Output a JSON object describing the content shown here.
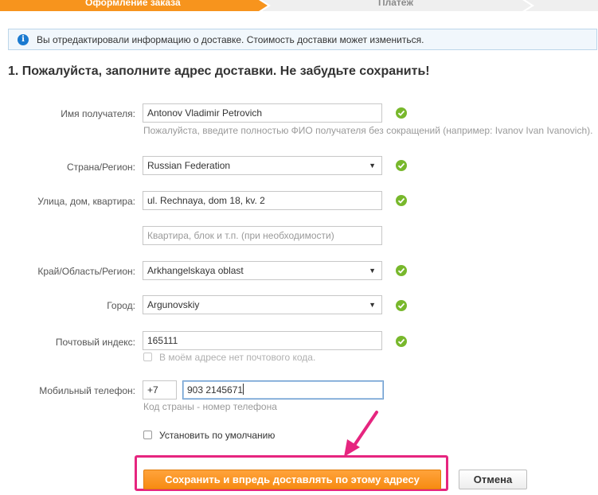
{
  "steps": [
    {
      "label": "Оформление заказа",
      "active": true
    },
    {
      "label": "Платёж",
      "active": false
    }
  ],
  "info": {
    "icon": "info-icon",
    "text": "Вы отредактировали информацию о доставке. Стоимость доставки может измениться."
  },
  "heading": "1. Пожалуйста, заполните адрес доставки. Не забудьте сохранить!",
  "form": {
    "recipient": {
      "label": "Имя получателя:",
      "value": "Antonov Vladimir Petrovich",
      "hint": "Пожалуйста, введите полностью ФИО получателя без сокращений (например: Ivanov Ivan Ivanovich)."
    },
    "country": {
      "label": "Страна/Регион:",
      "value": "Russian Federation"
    },
    "street": {
      "label": "Улица, дом, квартира:",
      "value": "ul. Rechnaya, dom 18, kv. 2"
    },
    "apartment": {
      "placeholder": "Квартира, блок и т.п. (при необходимости)"
    },
    "region": {
      "label": "Край/Область/Регион:",
      "value": "Arkhangelskaya oblast"
    },
    "city": {
      "label": "Город:",
      "value": "Argunovskiy"
    },
    "postal": {
      "label": "Почтовый индекс:",
      "value": "165111",
      "no_code_label": "В моём адресе нет почтового кода."
    },
    "phone": {
      "label": "Мобильный телефон:",
      "country_code": "+7",
      "number": "903 2145671",
      "hint": "Код страны - номер телефона"
    },
    "default_label": "Установить по умолчанию"
  },
  "buttons": {
    "save": "Сохранить и впредь доставлять по этому адресу",
    "cancel": "Отмена"
  },
  "colors": {
    "accent": "#f7941d",
    "check": "#78b82c",
    "highlight": "#e6257f",
    "info_icon": "#1a7ad0"
  }
}
